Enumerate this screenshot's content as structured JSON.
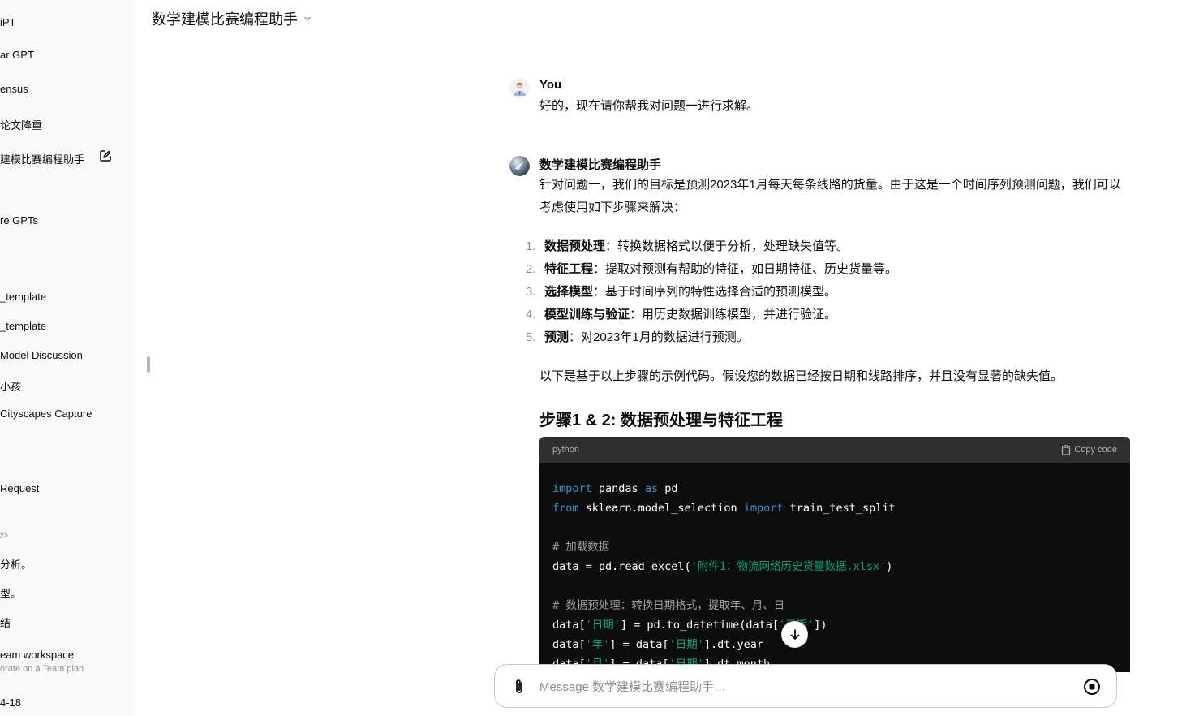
{
  "sidebar": {
    "items": [
      {
        "label": "iPT",
        "active": false
      },
      {
        "label": "ar GPT",
        "active": false
      },
      {
        "label": "ensus",
        "active": false
      },
      {
        "label": "论文降重",
        "active": false
      },
      {
        "label": "建模比赛编程助手",
        "active": true
      },
      {
        "label": "re GPTs",
        "active": false
      },
      {
        "label": "_template",
        "active": false
      },
      {
        "label": "_template",
        "active": false
      },
      {
        "label": "Model Discussion",
        "active": false
      },
      {
        "label": "小孩",
        "active": false
      },
      {
        "label": "Cityscapes Capture",
        "active": false
      },
      {
        "label": " Request",
        "active": false
      }
    ],
    "section_label": "ys",
    "recent": [
      {
        "label": "分析。"
      },
      {
        "label": "型。"
      },
      {
        "label": "结"
      }
    ],
    "team": {
      "title": "eam workspace",
      "subtitle": "orate on a Team plan"
    },
    "user": {
      "label": "4-18"
    }
  },
  "header": {
    "title": "数学建模比赛编程助手"
  },
  "conversation": {
    "user": {
      "author": "You",
      "text": "好的，现在请你帮我对问题一进行求解。"
    },
    "assistant": {
      "author": "数学建模比赛编程助手",
      "intro": "针对问题一，我们的目标是预测2023年1月每天每条线路的货量。由于这是一个时间序列预测问题，我们可以考虑使用如下步骤来解决：",
      "steps": [
        {
          "num": "1.",
          "title": "数据预处理",
          "text": "：转换数据格式以便于分析，处理缺失值等。"
        },
        {
          "num": "2.",
          "title": "特征工程",
          "text": "：提取对预测有帮助的特征，如日期特征、历史货量等。"
        },
        {
          "num": "3.",
          "title": "选择模型",
          "text": "：基于时间序列的特性选择合适的预测模型。"
        },
        {
          "num": "4.",
          "title": "模型训练与验证",
          "text": "：用历史数据训练模型，并进行验证。"
        },
        {
          "num": "5.",
          "title": "预测",
          "text": "：对2023年1月的数据进行预测。"
        }
      ],
      "after": "以下是基于以上步骤的示例代码。假设您的数据已经按日期和线路排序，并且没有显著的缺失值。",
      "heading": "步骤1 & 2: 数据预处理与特征工程",
      "code": {
        "language": "python",
        "copy_label": "Copy code",
        "lines": {
          "l1": {
            "kw1": "import",
            "t1": " pandas ",
            "kw2": "as",
            "t2": " pd"
          },
          "l2": {
            "kw1": "from",
            "t1": " sklearn.model_selection ",
            "kw2": "import",
            "t2": " train_test_split"
          },
          "l4": {
            "cm": "# 加载数据"
          },
          "l5": {
            "t1": "data = pd.read_excel(",
            "s1": "'附件1：物流网络历史货量数据.xlsx'",
            "t2": ")"
          },
          "l7": {
            "cm": "# 数据预处理：转换日期格式，提取年、月、日"
          },
          "l8": {
            "t1": "data[",
            "s1": "'日期'",
            "t2": "] = pd.to_datetime(data[",
            "s2": "'日期'",
            "t3": "])"
          },
          "l9": {
            "t1": "data[",
            "s1": "'年'",
            "t2": "] = data[",
            "s2": "'日期'",
            "t3": "].dt.year"
          },
          "l10": {
            "t1": "data[",
            "s1": "'月'",
            "t2": "] = data[",
            "s2": "'日期'",
            "t3": "].dt.month"
          }
        }
      }
    }
  },
  "composer": {
    "placeholder": "Message 数学建模比赛编程助手…"
  }
}
